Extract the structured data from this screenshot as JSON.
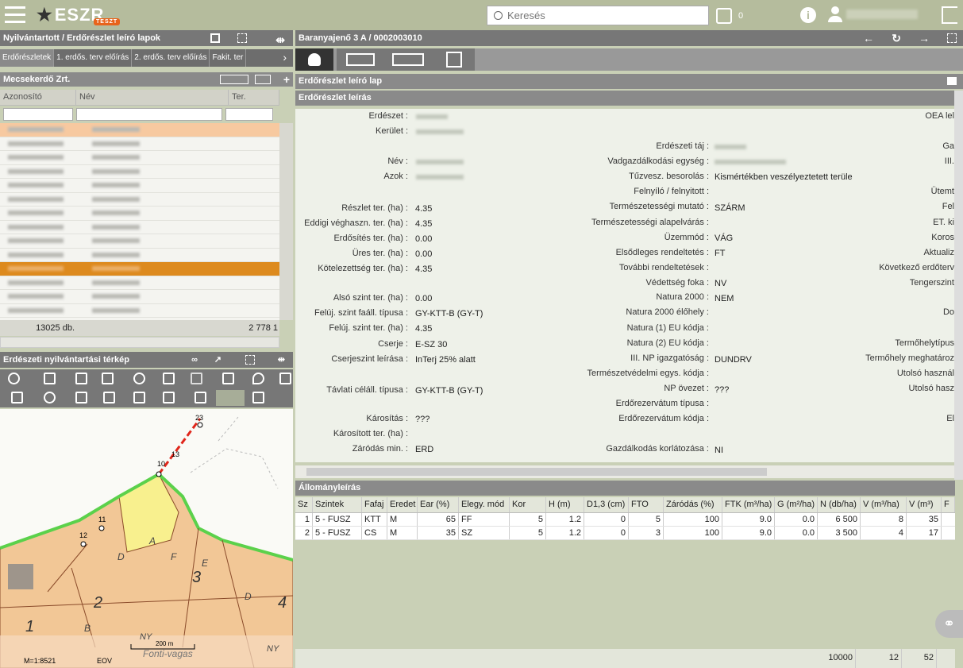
{
  "app": {
    "logo": "ESZR",
    "logo_badge": "TESZT",
    "search_placeholder": "Keresés",
    "msg_count": "0",
    "colors": {
      "topbar": "#b5bc9d",
      "panel": "#777777",
      "selected": "#dd8a1e",
      "selected_light": "#f7c9a0",
      "map_orange": "#f0c08a",
      "map_yellow": "#f7f08a"
    }
  },
  "left": {
    "title": "Nyilvántartott / Erdőrészlet leíró lapok",
    "tabs": [
      "Erdőrészletek",
      "1. erdős. terv előírás",
      "2. erdős. terv előírás",
      "Fakit. ter"
    ],
    "subtitle": "Mecsekerdő Zrt.",
    "columns": [
      "Azonosító",
      "Név",
      "Ter."
    ],
    "row_count": "13025 db.",
    "total": "2 778 1"
  },
  "map": {
    "title": "Erdészeti nyilvántartási térkép",
    "scale": "M=1:8521",
    "proj": "EOV",
    "scalebar": "200 m",
    "place": "Fonti-vagas",
    "labels": {
      "n1": "1",
      "n2": "2",
      "n3": "3",
      "n4": "4",
      "lA": "A",
      "lB": "B",
      "lD": "D",
      "lD2": "D",
      "lE": "E",
      "lF": "F",
      "lNY": "NY",
      "lNY2": "NY",
      "p10": "10",
      "p11": "11",
      "p12": "12",
      "p13": "13",
      "p23": "23"
    }
  },
  "right": {
    "title": "Baranyajenő 3 A / 0002003010",
    "sheet_title": "Erdőrészlet leíró lap",
    "section1": "Erdőrészlet leírás",
    "section2": "Állományleírás",
    "c1": {
      "erdeszet": "Erdészet :",
      "kerulet": "Kerület :",
      "nev": "Név :",
      "azok": "Azok :",
      "reszlet": "Részlet ter. (ha) :",
      "reszlet_v": "4.35",
      "eddigi": "Eddigi véghaszn. ter. (ha) :",
      "eddigi_v": "4.35",
      "erdosites": "Erdősítés ter. (ha) :",
      "erdosites_v": "0.00",
      "ures": "Üres ter. (ha) :",
      "ures_v": "0.00",
      "kotelez": "Kötelezettség ter. (ha) :",
      "kotelez_v": "4.35",
      "also": "Alsó szint ter. (ha) :",
      "also_v": "0.00",
      "feluj_tip": "Felúj. szint faáll. típusa :",
      "feluj_tip_v": "GY-KTT-B (GY-T)",
      "feluj_ter": "Felúj. szint ter. (ha) :",
      "feluj_ter_v": "4.35",
      "cserje": "Cserje :",
      "cserje_v": "E-SZ 30",
      "cserjeszint": "Cserjeszint leírása :",
      "cserjeszint_v": "InTerj 25% alatt",
      "tavlati": "Távlati céláll. típusa :",
      "tavlati_v": "GY-KTT-B (GY-T)",
      "karositas": "Károsítás :",
      "karositas_v": "???",
      "karositott": "Károsított ter. (ha) :",
      "zarodas": "Záródás min. :",
      "zarodas_v": "ERD"
    },
    "c2": {
      "taj": "Erdészeti táj :",
      "vadg": "Vadgazdálkodási egység :",
      "tuzvesz": "Tűzvesz. besorolás :",
      "tuzvesz_v": "Kismértékben veszélyeztetett terüle",
      "felnyilo": "Felnyíló / felnyitott :",
      "termmut": "Természetességi mutató :",
      "termmut_v": "SZÁRM",
      "termalap": "Természetességi alapelvárás :",
      "uzemmod": "Üzemmód :",
      "uzemmod_v": "VÁG",
      "elsodleges": "Elsődleges rendeltetés :",
      "elsodleges_v": "FT",
      "tovabbi": "További rendeltetések :",
      "vedettseg": "Védettség foka :",
      "vedettseg_v": "NV",
      "natura": "Natura 2000 :",
      "natura_v": "NEM",
      "natura_elo": "Natura 2000 élőhely :",
      "natura1": "Natura (1) EU kódja :",
      "natura2": "Natura (2) EU kódja :",
      "np": "III. NP igazgatóság :",
      "np_v": "DUNDRV",
      "termved": "Természetvédelmi egys. kódja :",
      "npoveze": "NP övezet :",
      "npoveze_v": "???",
      "erdorez_tip": "Erdőrezervátum típusa :",
      "erdorez_kod": "Erdőrezervátum kódja :",
      "gazd": "Gazdálkodás korlátozása :",
      "gazd_v": "NI"
    },
    "c3": {
      "oea": "OEA lel",
      "ga": "Ga",
      "iii": "III.",
      "utemt": "Ütemt",
      "fel": "Fel",
      "et": "ET. ki",
      "koros": "Koros",
      "aktual": "Aktualiz",
      "kovetkezo": "Következő erdőterv",
      "tengersz": "Tengerszint",
      "do": "Do",
      "termohelytip": "Termőhelytípus",
      "termohelymeg": "Termőhely meghatároz",
      "utolso1": "Utolsó használ",
      "utolso2": "Utolsó hasz",
      "el": "El"
    },
    "table": {
      "headers": [
        "Sz",
        "Szintek",
        "Fafaj",
        "Eredet",
        "Ear (%)",
        "Elegy. mód",
        "Kor",
        "H (m)",
        "D1,3 (cm)",
        "FTO",
        "Záródás (%)",
        "FTK (m³/ha)",
        "G (m²/ha)",
        "N (db/ha)",
        "V (m³/ha)",
        "V (m³)",
        "F"
      ],
      "rows": [
        [
          "1",
          "5 - FUSZ",
          "KTT",
          "M",
          "65",
          "FF",
          "5",
          "1.2",
          "0",
          "5",
          "100",
          "9.0",
          "0.0",
          "6 500",
          "8",
          "35"
        ],
        [
          "2",
          "5 - FUSZ",
          "CS",
          "M",
          "35",
          "SZ",
          "5",
          "1.2",
          "0",
          "3",
          "100",
          "9.0",
          "0.0",
          "3 500",
          "4",
          "17"
        ]
      ],
      "footer": {
        "n": "10000",
        "vha": "12",
        "v": "52"
      }
    }
  }
}
